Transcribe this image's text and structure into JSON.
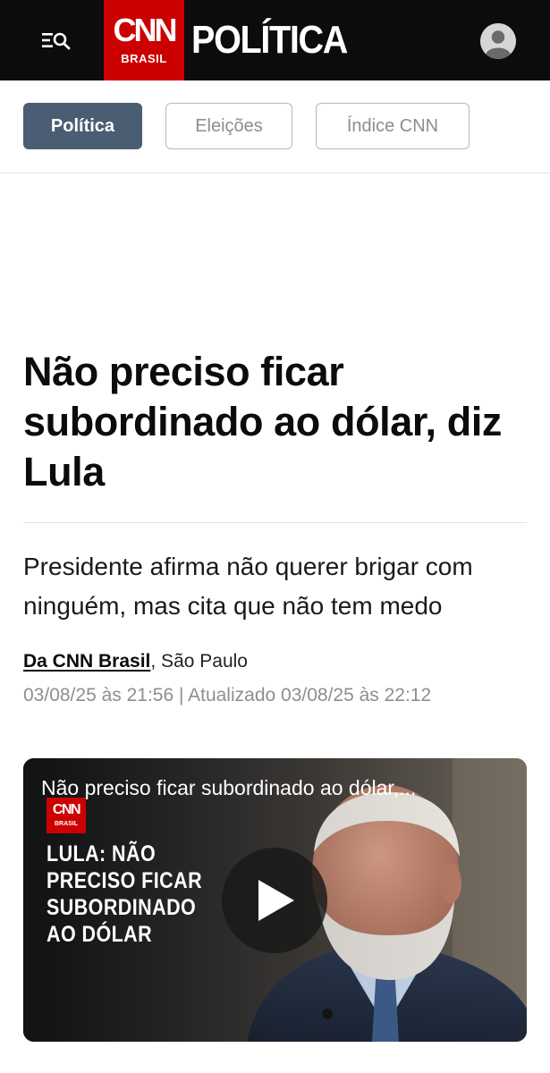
{
  "header": {
    "menu_icon": "menu-search-icon",
    "logo": {
      "primary": "CNN",
      "secondary": "BRASIL"
    },
    "section": "POLÍTICA",
    "avatar_icon": "user-avatar-icon"
  },
  "tabs": [
    {
      "label": "Política",
      "active": true
    },
    {
      "label": "Eleições",
      "active": false
    },
    {
      "label": "Índice CNN",
      "active": false
    }
  ],
  "article": {
    "headline": "Não preciso ficar subordinado ao dólar, diz Lula",
    "subtitle": "Presidente afirma não querer brigar com ninguém, mas cita que não tem medo",
    "author": "Da CNN Brasil",
    "location": ", São Paulo",
    "timestamp": "03/08/25 às 21:56 | Atualizado 03/08/25 às 22:12"
  },
  "video": {
    "title": "Não preciso ficar subordinado ao dólar,...",
    "overlay_text": "LULA: NÃO PRECISO FICAR SUBORDINADO AO DÓLAR",
    "logo": {
      "primary": "CNN",
      "secondary": "BRASIL"
    },
    "play_icon": "play-icon"
  },
  "colors": {
    "topbar": "#0c0c0c",
    "brand_red": "#cc0000",
    "active_tab": "#4a5d72",
    "muted_text": "#8e8e8e"
  }
}
